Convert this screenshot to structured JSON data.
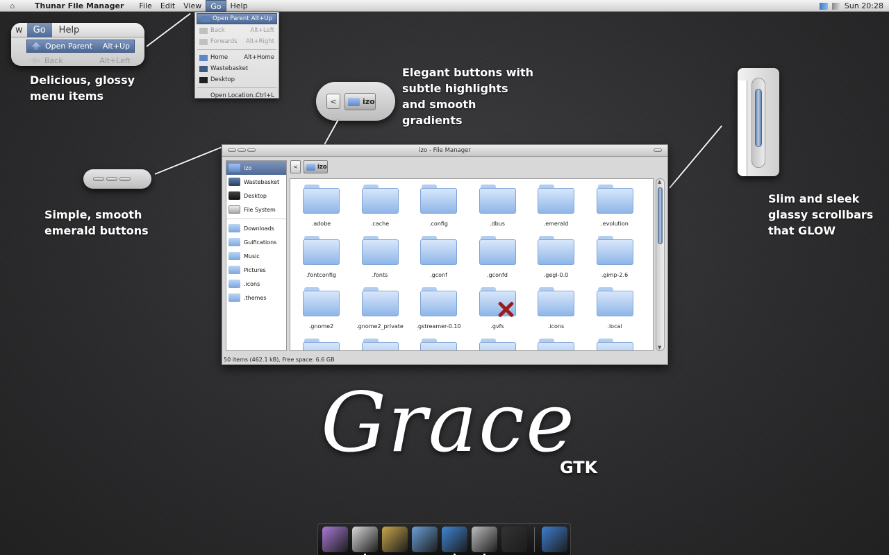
{
  "panel": {
    "app_title": "Thunar File Manager",
    "menus": [
      "File",
      "Edit",
      "View",
      "Go",
      "Help"
    ],
    "active_menu": "Go",
    "clock": "Sun 20:28"
  },
  "go_menu": {
    "items": [
      {
        "label": "Open Parent",
        "accel": "Alt+Up",
        "state": "selected"
      },
      {
        "label": "Back",
        "accel": "Alt+Left",
        "state": "disabled"
      },
      {
        "label": "Forwards",
        "accel": "Alt+Right",
        "state": "disabled"
      },
      {
        "label": "Home",
        "accel": "Alt+Home",
        "state": "normal"
      },
      {
        "label": "Wastebasket",
        "accel": "",
        "state": "normal"
      },
      {
        "label": "Desktop",
        "accel": "",
        "state": "normal"
      },
      {
        "label": "Open Location...",
        "accel": "Ctrl+L",
        "state": "normal"
      }
    ]
  },
  "zoom_menu": {
    "bar_left": "w",
    "bar_active": "Go",
    "bar_right": "Help",
    "item1_label": "Open Parent",
    "item1_accel": "Alt+Up",
    "item2_label": "Back",
    "item2_accel": "Alt+Left"
  },
  "zoom_nav": {
    "back": "<",
    "crumb": "izo"
  },
  "callouts": {
    "menus": "Delicious, glossy menu items",
    "buttons": "Elegant buttons with subtle highlights and smooth gradients",
    "emerald": "Simple, smooth emerald buttons",
    "scrollbars": "Slim and sleek glassy scrollbars that GLOW"
  },
  "window": {
    "title": "izo - File Manager",
    "breadcrumb": "izo",
    "back": "<",
    "status": "50 items (462.1 kB), Free space: 6.6 GB",
    "sidebar": [
      {
        "label": "izo",
        "icon": "home-icon",
        "selected": true
      },
      {
        "label": "Wastebasket",
        "icon": "trash-icon"
      },
      {
        "label": "Desktop",
        "icon": "desktop-icon"
      },
      {
        "label": "File System",
        "icon": "filesystem-icon"
      },
      {
        "separator": true
      },
      {
        "label": "Downloads",
        "icon": "folder-icon"
      },
      {
        "label": "Guifications",
        "icon": "folder-icon"
      },
      {
        "label": "Music",
        "icon": "folder-icon"
      },
      {
        "label": "Pictures",
        "icon": "folder-icon"
      },
      {
        "label": ".icons",
        "icon": "folder-icon"
      },
      {
        "label": ".themes",
        "icon": "folder-icon"
      }
    ],
    "files": [
      ".adobe",
      ".cache",
      ".config",
      ".dbus",
      ".emerald",
      ".evolution",
      ".fontconfig",
      ".fonts",
      ".gconf",
      ".gconfd",
      ".gegl-0.0",
      ".gimp-2.6",
      ".gnome2",
      ".gnome2_private",
      ".gstreamer-0.10",
      ".gvfs",
      ".icons",
      ".local",
      "",
      "",
      "",
      "",
      "",
      ""
    ],
    "broken_file": ".gvfs"
  },
  "logo": {
    "title": "Grace",
    "subtitle": "GTK"
  },
  "dock": {
    "items": [
      {
        "name": "settings-icon",
        "color": "#a97ad6",
        "running": false
      },
      {
        "name": "package-icon",
        "color": "#d9d9d9",
        "running": true
      },
      {
        "name": "speaker-icon",
        "color": "#c9a64a",
        "running": false
      },
      {
        "name": "image-viewer-icon",
        "color": "#6aa0d8",
        "running": false
      },
      {
        "name": "browser-globe-icon",
        "color": "#3f86d6",
        "running": true
      },
      {
        "name": "cube-icon",
        "color": "#bdbdbd",
        "running": true
      },
      {
        "name": "terminal-icon",
        "color": "#333333",
        "running": false
      },
      {
        "name": "trash-bin-icon",
        "color": "#3d7fd1",
        "running": false
      }
    ]
  }
}
